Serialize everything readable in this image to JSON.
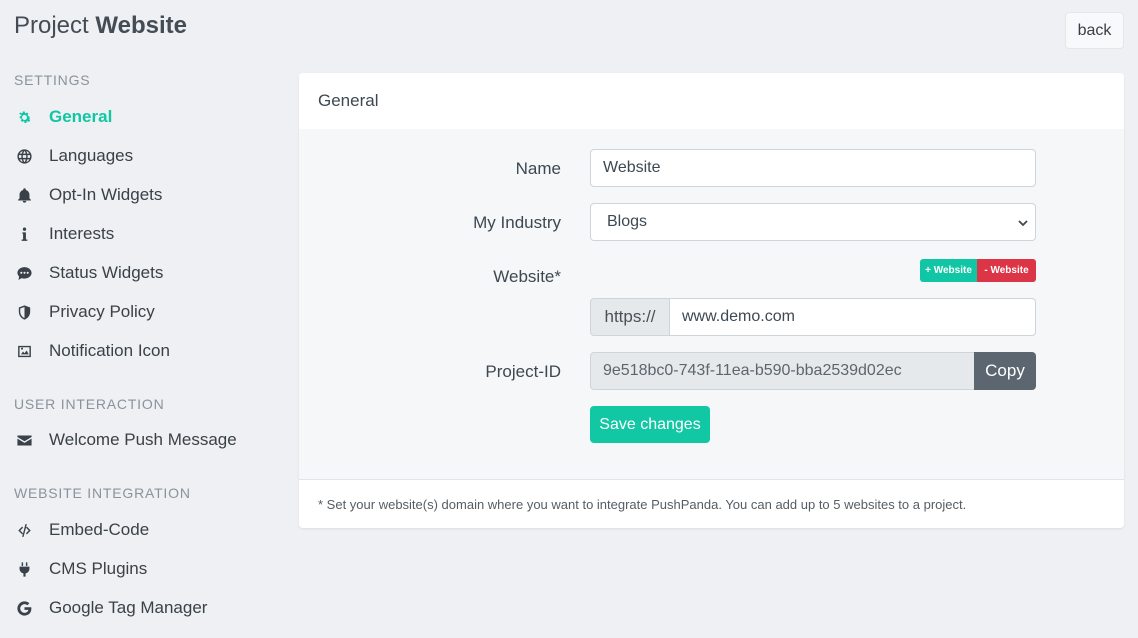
{
  "header": {
    "title_prefix": "Project",
    "title_name": "Website",
    "back_label": "back"
  },
  "sidebar": {
    "sections": [
      {
        "title": "SETTINGS",
        "items": [
          {
            "label": "General",
            "icon": "gear-icon",
            "active": true
          },
          {
            "label": "Languages",
            "icon": "globe-icon"
          },
          {
            "label": "Opt-In Widgets",
            "icon": "bell-icon"
          },
          {
            "label": "Interests",
            "icon": "info-icon"
          },
          {
            "label": "Status Widgets",
            "icon": "comment-icon"
          },
          {
            "label": "Privacy Policy",
            "icon": "shield-icon"
          },
          {
            "label": "Notification Icon",
            "icon": "image-icon"
          }
        ]
      },
      {
        "title": "USER INTERACTION",
        "items": [
          {
            "label": "Welcome Push Message",
            "icon": "envelope-icon"
          }
        ]
      },
      {
        "title": "WEBSITE INTEGRATION",
        "items": [
          {
            "label": "Embed-Code",
            "icon": "code-icon"
          },
          {
            "label": "CMS Plugins",
            "icon": "plug-icon"
          },
          {
            "label": "Google Tag Manager",
            "icon": "google-icon"
          }
        ]
      }
    ]
  },
  "card": {
    "title": "General",
    "form": {
      "name_label": "Name",
      "name_value": "Website",
      "industry_label": "My Industry",
      "industry_value": "Blogs",
      "website_label": "Website*",
      "add_website_label": "+ Website",
      "remove_website_label": "- Website",
      "protocol": "https://",
      "website_value": "www.demo.com",
      "project_id_label": "Project-ID",
      "project_id_value": "9e518bc0-743f-11ea-b590-bba2539d02ec",
      "copy_label": "Copy",
      "save_label": "Save changes"
    },
    "footer_note": "* Set your website(s) domain where you want to integrate PushPanda. You can add up to 5 websites to a project."
  },
  "colors": {
    "accent": "#11c6a4",
    "danger": "#dc3545",
    "secondary": "#5c6670"
  }
}
